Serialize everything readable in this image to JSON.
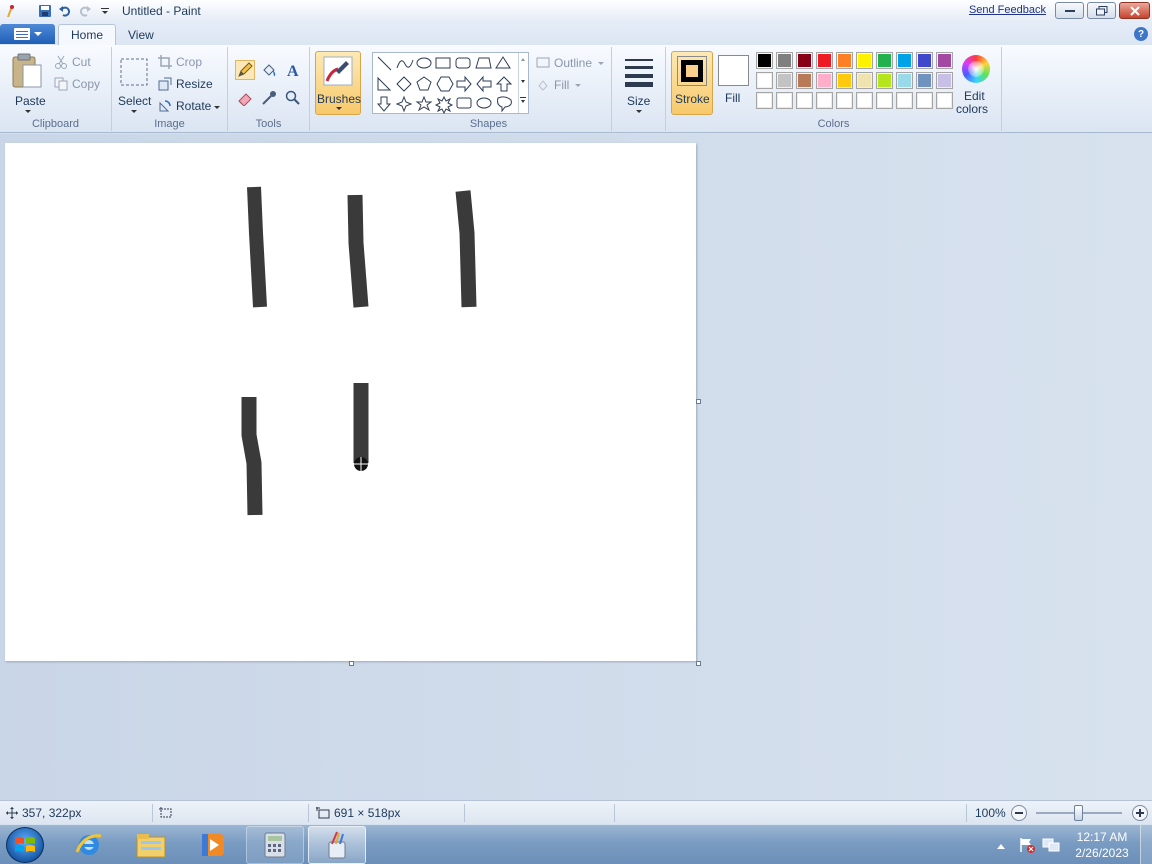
{
  "window": {
    "title": "Untitled - Paint",
    "send_feedback": "Send Feedback"
  },
  "tabs": {
    "home": "Home",
    "view": "View"
  },
  "ribbon": {
    "clipboard": {
      "label": "Clipboard",
      "paste": "Paste",
      "cut": "Cut",
      "copy": "Copy"
    },
    "image": {
      "label": "Image",
      "select": "Select",
      "crop": "Crop",
      "resize": "Resize",
      "rotate": "Rotate"
    },
    "tools": {
      "label": "Tools"
    },
    "brushes": {
      "label": "Brushes"
    },
    "shapes": {
      "label": "Shapes",
      "outline": "Outline",
      "fill": "Fill"
    },
    "size": {
      "label": "Size"
    },
    "colors": {
      "label": "Colors",
      "stroke": "Stroke",
      "fill": "Fill",
      "edit": "Edit colors",
      "stroke_color": "#000000",
      "fill_color": "#ffffff",
      "palette_row1": [
        "#000000",
        "#7f7f7f",
        "#880015",
        "#ed1c24",
        "#ff7f27",
        "#fff200",
        "#22b14c",
        "#00a2e8",
        "#3f48cc",
        "#a349a4"
      ],
      "palette_row2": [
        "#ffffff",
        "#c3c3c3",
        "#b97a57",
        "#ffaec9",
        "#ffc90e",
        "#efe4b0",
        "#b5e61d",
        "#99d9ea",
        "#7092be",
        "#c8bfe7"
      ],
      "palette_row3": [
        "#ffffff",
        "#ffffff",
        "#ffffff",
        "#ffffff",
        "#ffffff",
        "#ffffff",
        "#ffffff",
        "#ffffff",
        "#ffffff",
        "#ffffff"
      ]
    }
  },
  "status": {
    "cursor_pos": "357, 322px",
    "canvas_size": "691 × 518px",
    "zoom": "100%",
    "zoom_level": 1.0
  },
  "taskbar": {
    "time": "12:17 AM",
    "date": "2/26/2023"
  }
}
